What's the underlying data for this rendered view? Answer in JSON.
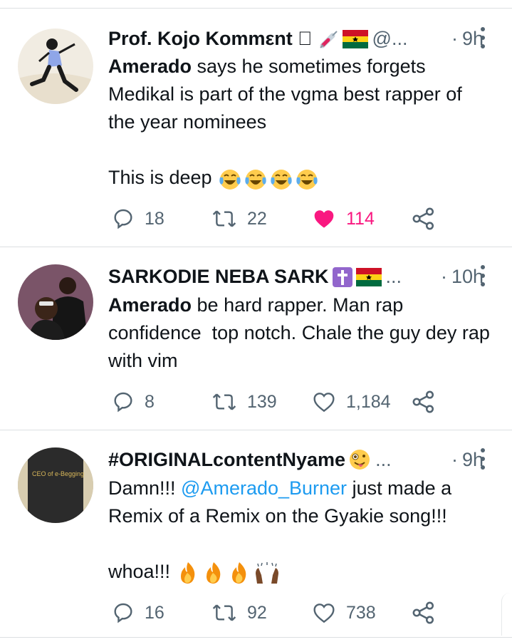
{
  "tweets": [
    {
      "name": "Prof. Kojo Kommεnt ⃝",
      "handle": "@...",
      "time": "9h",
      "avatar_icon": "avatar-illustration",
      "name_icons": [
        "syringe-icon",
        "ghana-flag-icon"
      ],
      "text_bold": "Amerado",
      "text_rest": " says he sometimes forgets Medikal is part of the vgma best rapper of the year nominees",
      "text_line2": "This is deep",
      "emoji": [
        "laughing-crying-icon",
        "laughing-crying-icon",
        "laughing-crying-icon",
        "laughing-crying-icon"
      ],
      "replies": "18",
      "retweets": "22",
      "likes": "114",
      "liked": true
    },
    {
      "name": "SARKODIE NEBA SARK",
      "handle": "...",
      "time": "10h",
      "avatar_icon": "avatar-photo",
      "name_icons": [
        "cross-icon",
        "ghana-flag-icon"
      ],
      "text_bold": "Amerado",
      "text_rest": " be hard rapper. Man rap confidence  top notch. Chale the guy dey rap with vim",
      "replies": "8",
      "retweets": "139",
      "likes": "1,184",
      "liked": false
    },
    {
      "name": "#ORIGINALcontentNyame",
      "handle": "...",
      "time": "9h",
      "avatar_icon": "avatar-shirt-photo",
      "avatar_shirt_text": "CEO of e-Begging",
      "name_icons": [
        "zany-face-icon"
      ],
      "text_pre": "Damn!!! ",
      "text_mention": "@Amerado_Burner",
      "text_post": " just made a Remix of a Remix on the Gyakie song!!!",
      "text_line2": "whoa!!!",
      "emoji": [
        "fire-icon",
        "fire-icon",
        "fire-icon",
        "raising-hands-icon"
      ],
      "replies": "16",
      "retweets": "92",
      "likes": "738",
      "liked": false
    }
  ],
  "colors": {
    "text": "#0f1419",
    "muted": "#536471",
    "link": "#1d9bf0",
    "like": "#f91880",
    "divider": "#dcdfe2"
  }
}
